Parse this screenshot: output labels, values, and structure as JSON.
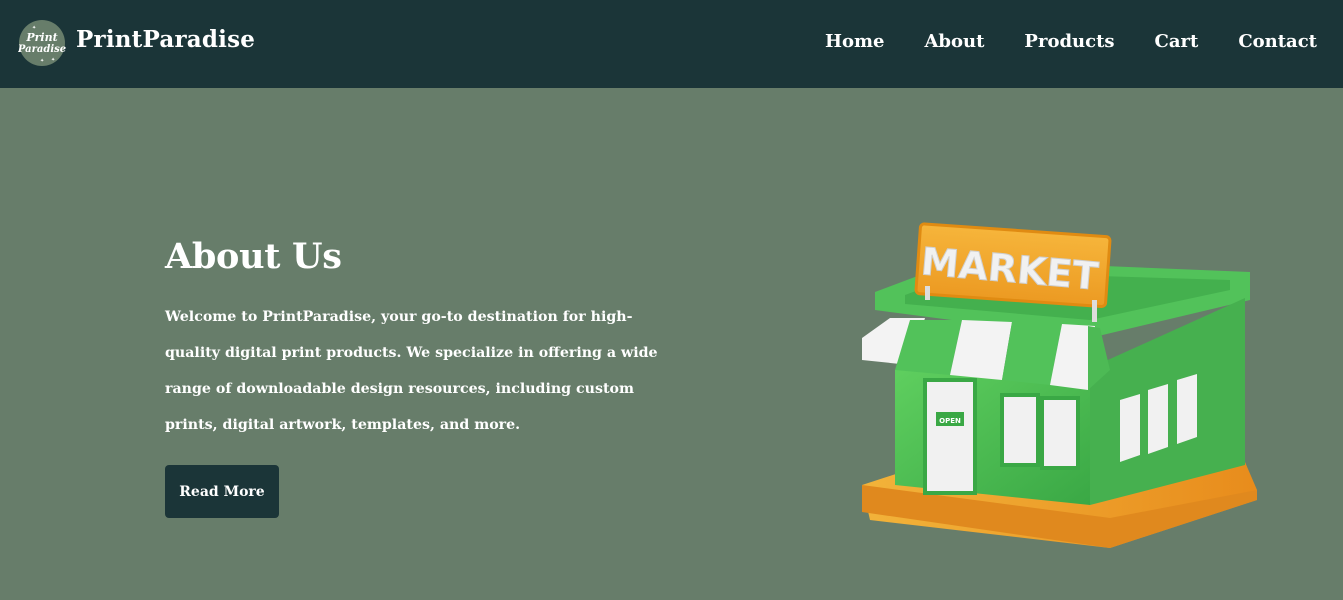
{
  "brand": {
    "name": "PrintParadise",
    "logo_text_top": "Print",
    "logo_text_bottom": "Paradise"
  },
  "nav": {
    "items": [
      "Home",
      "About",
      "Products",
      "Cart",
      "Contact"
    ]
  },
  "about": {
    "title": "About Us",
    "intro_before": "Welcome to ",
    "intro_brand": "PrintParadise",
    "intro_after": ", your go-to destination for high-quality digital print products. We specialize in offering a wide range of downloadable design resources, including custom prints, digital artwork, templates, and more.",
    "button_label": "Read More"
  },
  "illustration": {
    "sign_text": "MARKET",
    "door_sign_text": "OPEN"
  },
  "colors": {
    "navbar": "#1b3538",
    "page_background": "#677d6a",
    "button": "#1b3538"
  }
}
